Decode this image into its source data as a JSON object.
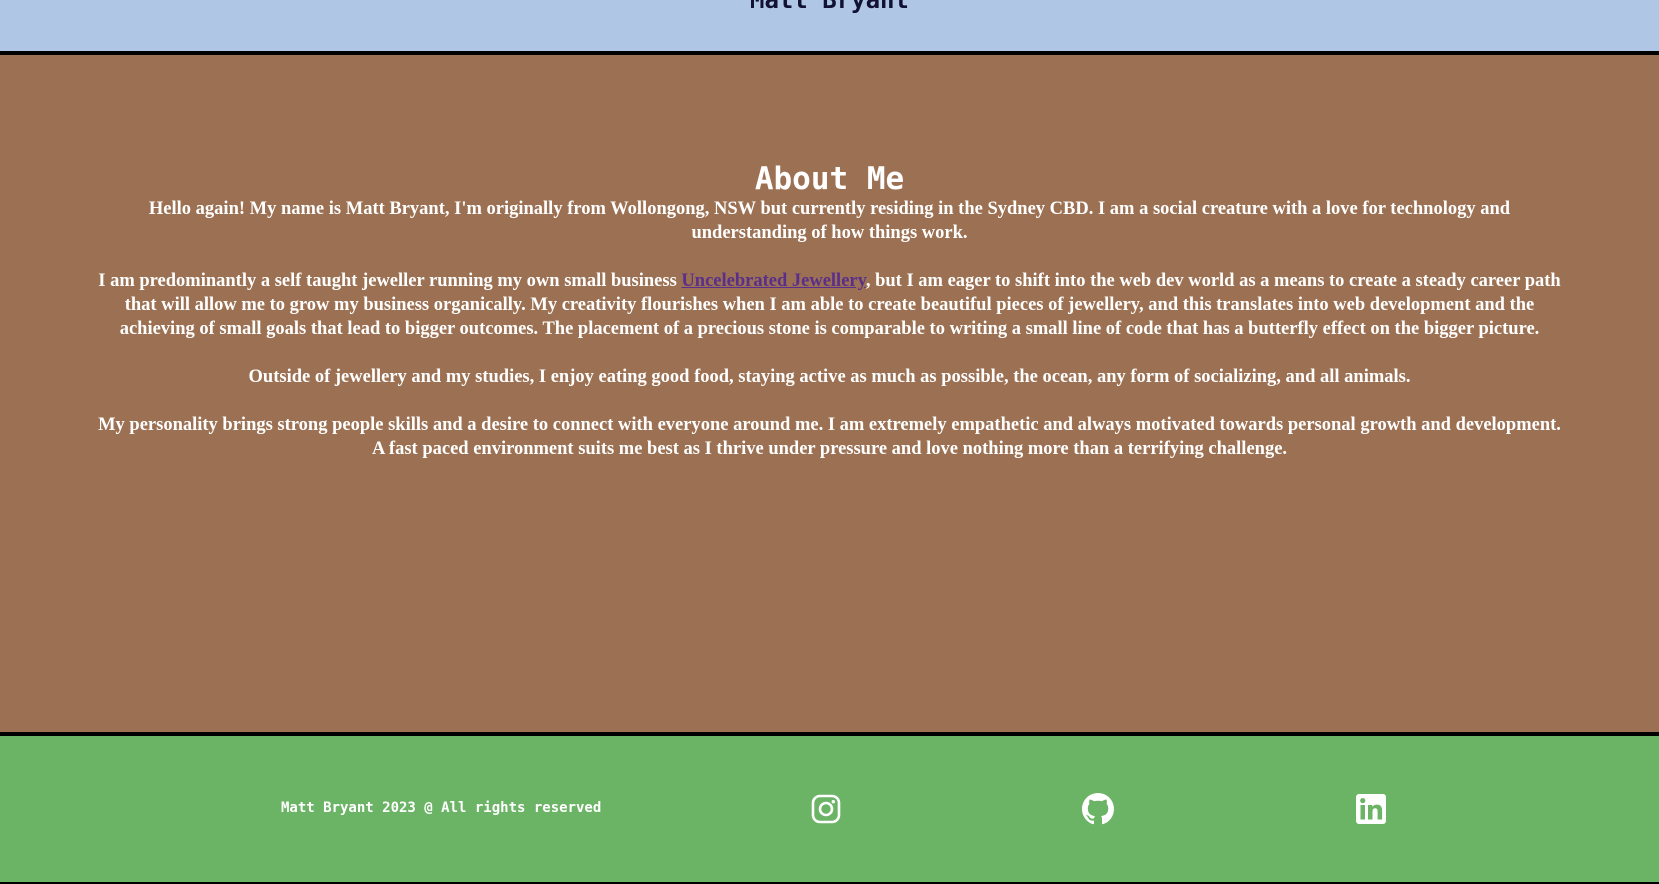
{
  "header": {
    "title": "Matt Bryant"
  },
  "about": {
    "title": "About Me",
    "p1": "Hello again! My name is Matt Bryant, I'm originally from Wollongong, NSW but currently residing in the Sydney CBD. I am a social creature with a love for technology and understanding of how things work.",
    "p2_before": "I am predominantly a self taught jeweller running my own small business ",
    "p2_link": "Uncelebrated Jewellery",
    "p2_after": ", but I am eager to shift into the web dev world as a means to create a steady career path that will allow me to grow my business organically. My creativity flourishes when I am able to create beautiful pieces of jewellery, and this translates into web development and the achieving of small goals that lead to bigger outcomes. The placement of a precious stone is comparable to writing a small line of code that has a butterfly effect on the bigger picture.",
    "p3": "Outside of jewellery and my studies, I enjoy eating good food, staying active as much as possible, the ocean, any form of socializing, and all animals.",
    "p4": "My personality brings strong people skills and a desire to connect with everyone around me. I am extremely empathetic and always motivated towards personal growth and development. A fast paced environment suits me best as I thrive under pressure and love nothing more than a terrifying challenge."
  },
  "footer": {
    "copyright": "Matt Bryant 2023 @ All rights reserved",
    "icons": [
      "instagram-icon",
      "github-icon",
      "linkedin-icon"
    ]
  },
  "colors": {
    "header_bg": "#afc6e4",
    "about_bg": "#9c7052",
    "footer_bg": "#6bb365",
    "link": "#5a2f8a",
    "text": "#ffffff"
  }
}
